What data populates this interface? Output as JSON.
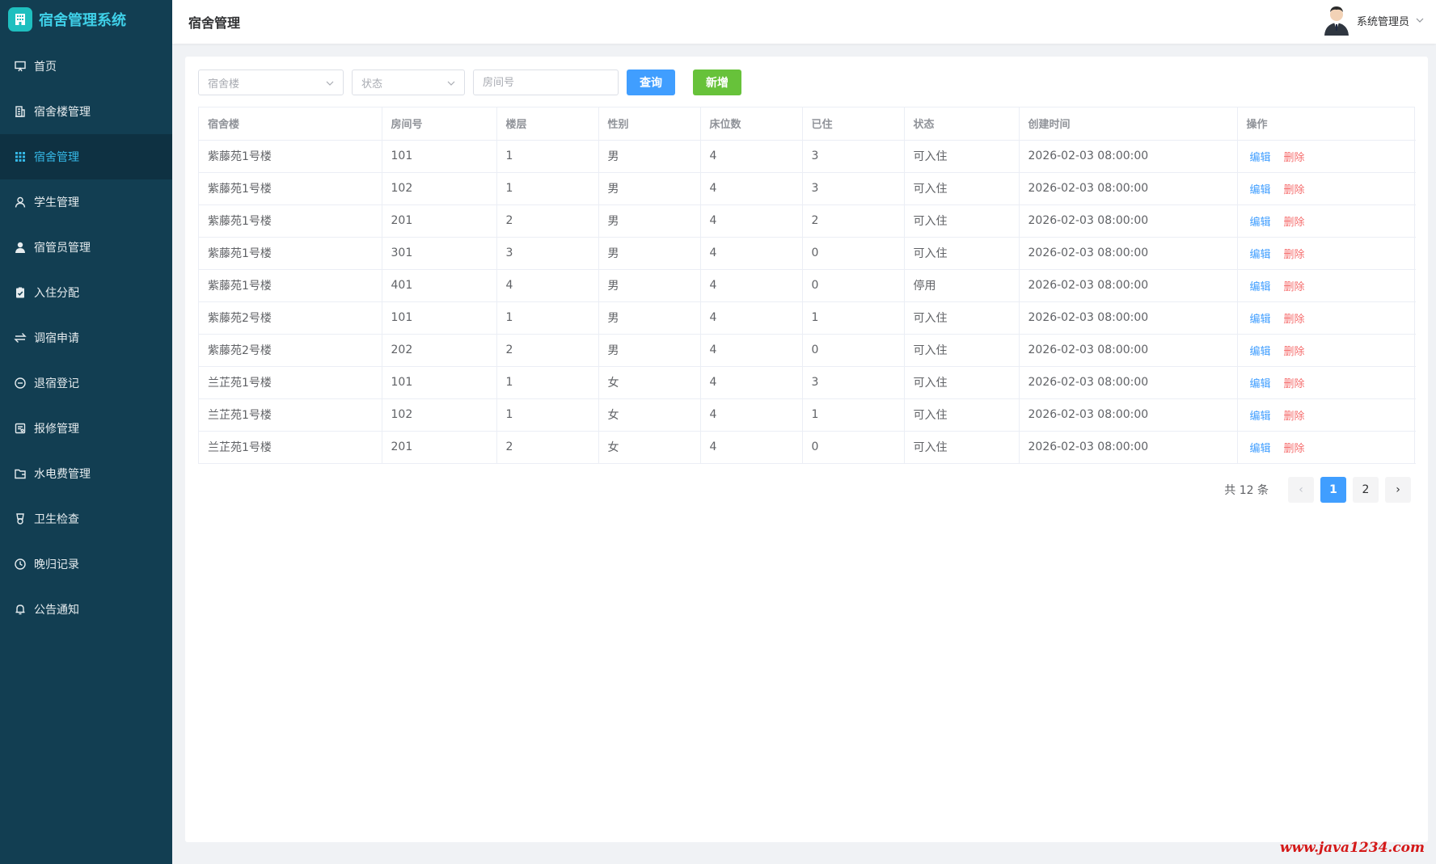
{
  "app": {
    "title": "宿舍管理系统"
  },
  "header": {
    "title": "宿舍管理",
    "user_name": "系统管理员"
  },
  "sidebar": {
    "items": [
      {
        "label": "首页",
        "icon": "monitor-icon"
      },
      {
        "label": "宿舍楼管理",
        "icon": "building-icon"
      },
      {
        "label": "宿舍管理",
        "icon": "grid-icon",
        "active": true
      },
      {
        "label": "学生管理",
        "icon": "user-icon"
      },
      {
        "label": "宿管员管理",
        "icon": "user-filled-icon"
      },
      {
        "label": "入住分配",
        "icon": "clipboard-check-icon"
      },
      {
        "label": "调宿申请",
        "icon": "switch-icon"
      },
      {
        "label": "退宿登记",
        "icon": "remove-circle-icon"
      },
      {
        "label": "报修管理",
        "icon": "tools-icon"
      },
      {
        "label": "水电费管理",
        "icon": "folder-icon"
      },
      {
        "label": "卫生检查",
        "icon": "medal-icon"
      },
      {
        "label": "晚归记录",
        "icon": "clock-icon"
      },
      {
        "label": "公告通知",
        "icon": "bell-icon"
      }
    ]
  },
  "filters": {
    "building_placeholder": "宿舍楼",
    "status_placeholder": "状态",
    "room_placeholder": "房间号",
    "search_label": "查询",
    "add_label": "新增"
  },
  "table": {
    "columns": [
      "宿舍楼",
      "房间号",
      "楼层",
      "性别",
      "床位数",
      "已住",
      "状态",
      "创建时间",
      "操作"
    ],
    "edit_label": "编辑",
    "delete_label": "删除",
    "rows": [
      [
        "紫藤苑1号楼",
        "101",
        "1",
        "男",
        "4",
        "3",
        "可入住",
        "2026-02-03 08:00:00"
      ],
      [
        "紫藤苑1号楼",
        "102",
        "1",
        "男",
        "4",
        "3",
        "可入住",
        "2026-02-03 08:00:00"
      ],
      [
        "紫藤苑1号楼",
        "201",
        "2",
        "男",
        "4",
        "2",
        "可入住",
        "2026-02-03 08:00:00"
      ],
      [
        "紫藤苑1号楼",
        "301",
        "3",
        "男",
        "4",
        "0",
        "可入住",
        "2026-02-03 08:00:00"
      ],
      [
        "紫藤苑1号楼",
        "401",
        "4",
        "男",
        "4",
        "0",
        "停用",
        "2026-02-03 08:00:00"
      ],
      [
        "紫藤苑2号楼",
        "101",
        "1",
        "男",
        "4",
        "1",
        "可入住",
        "2026-02-03 08:00:00"
      ],
      [
        "紫藤苑2号楼",
        "202",
        "2",
        "男",
        "4",
        "0",
        "可入住",
        "2026-02-03 08:00:00"
      ],
      [
        "兰芷苑1号楼",
        "101",
        "1",
        "女",
        "4",
        "3",
        "可入住",
        "2026-02-03 08:00:00"
      ],
      [
        "兰芷苑1号楼",
        "102",
        "1",
        "女",
        "4",
        "1",
        "可入住",
        "2026-02-03 08:00:00"
      ],
      [
        "兰芷苑1号楼",
        "201",
        "2",
        "女",
        "4",
        "0",
        "可入住",
        "2026-02-03 08:00:00"
      ]
    ]
  },
  "pagination": {
    "total_label": "共 12 条",
    "prev_symbol": "‹",
    "next_symbol": "›",
    "pages": [
      "1",
      "2"
    ],
    "current_page": "1"
  },
  "watermark": "www.java1234.com",
  "colors": {
    "sidebar_bg": "#123e52",
    "sidebar_active_bg": "#0e3142",
    "sidebar_active_text": "#35b8e6",
    "brand_text": "#3fd0e8",
    "primary": "#409eff",
    "success": "#67c23a",
    "danger": "#f56c6c",
    "watermark": "#d41818"
  }
}
